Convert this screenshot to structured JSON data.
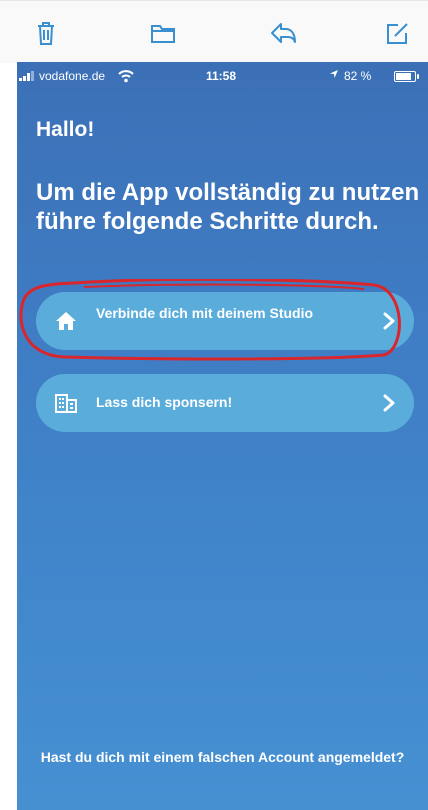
{
  "toolbar": {
    "icons": [
      "trash-icon",
      "folder-icon",
      "reply-icon",
      "compose-icon"
    ]
  },
  "statusbar": {
    "carrier": "vodafone.de",
    "time": "11:58",
    "battery": "82 %",
    "battery_level": 0.82
  },
  "main": {
    "greeting": "Hallo!",
    "headline": "Um die App vollständig zu nutzen führe folgende Schritte durch.",
    "steps": [
      {
        "label": "Verbinde dich mit deinem Studio",
        "icon": "home-icon",
        "highlighted": true
      },
      {
        "label": "Lass dich sponsern!",
        "icon": "building-icon",
        "highlighted": false
      }
    ],
    "footer": "Hast du dich mit einem falschen Account angemeldet?"
  },
  "colors": {
    "accent": "#3a8fd0",
    "card": "#5aacdb",
    "highlight": "#d9262c"
  }
}
